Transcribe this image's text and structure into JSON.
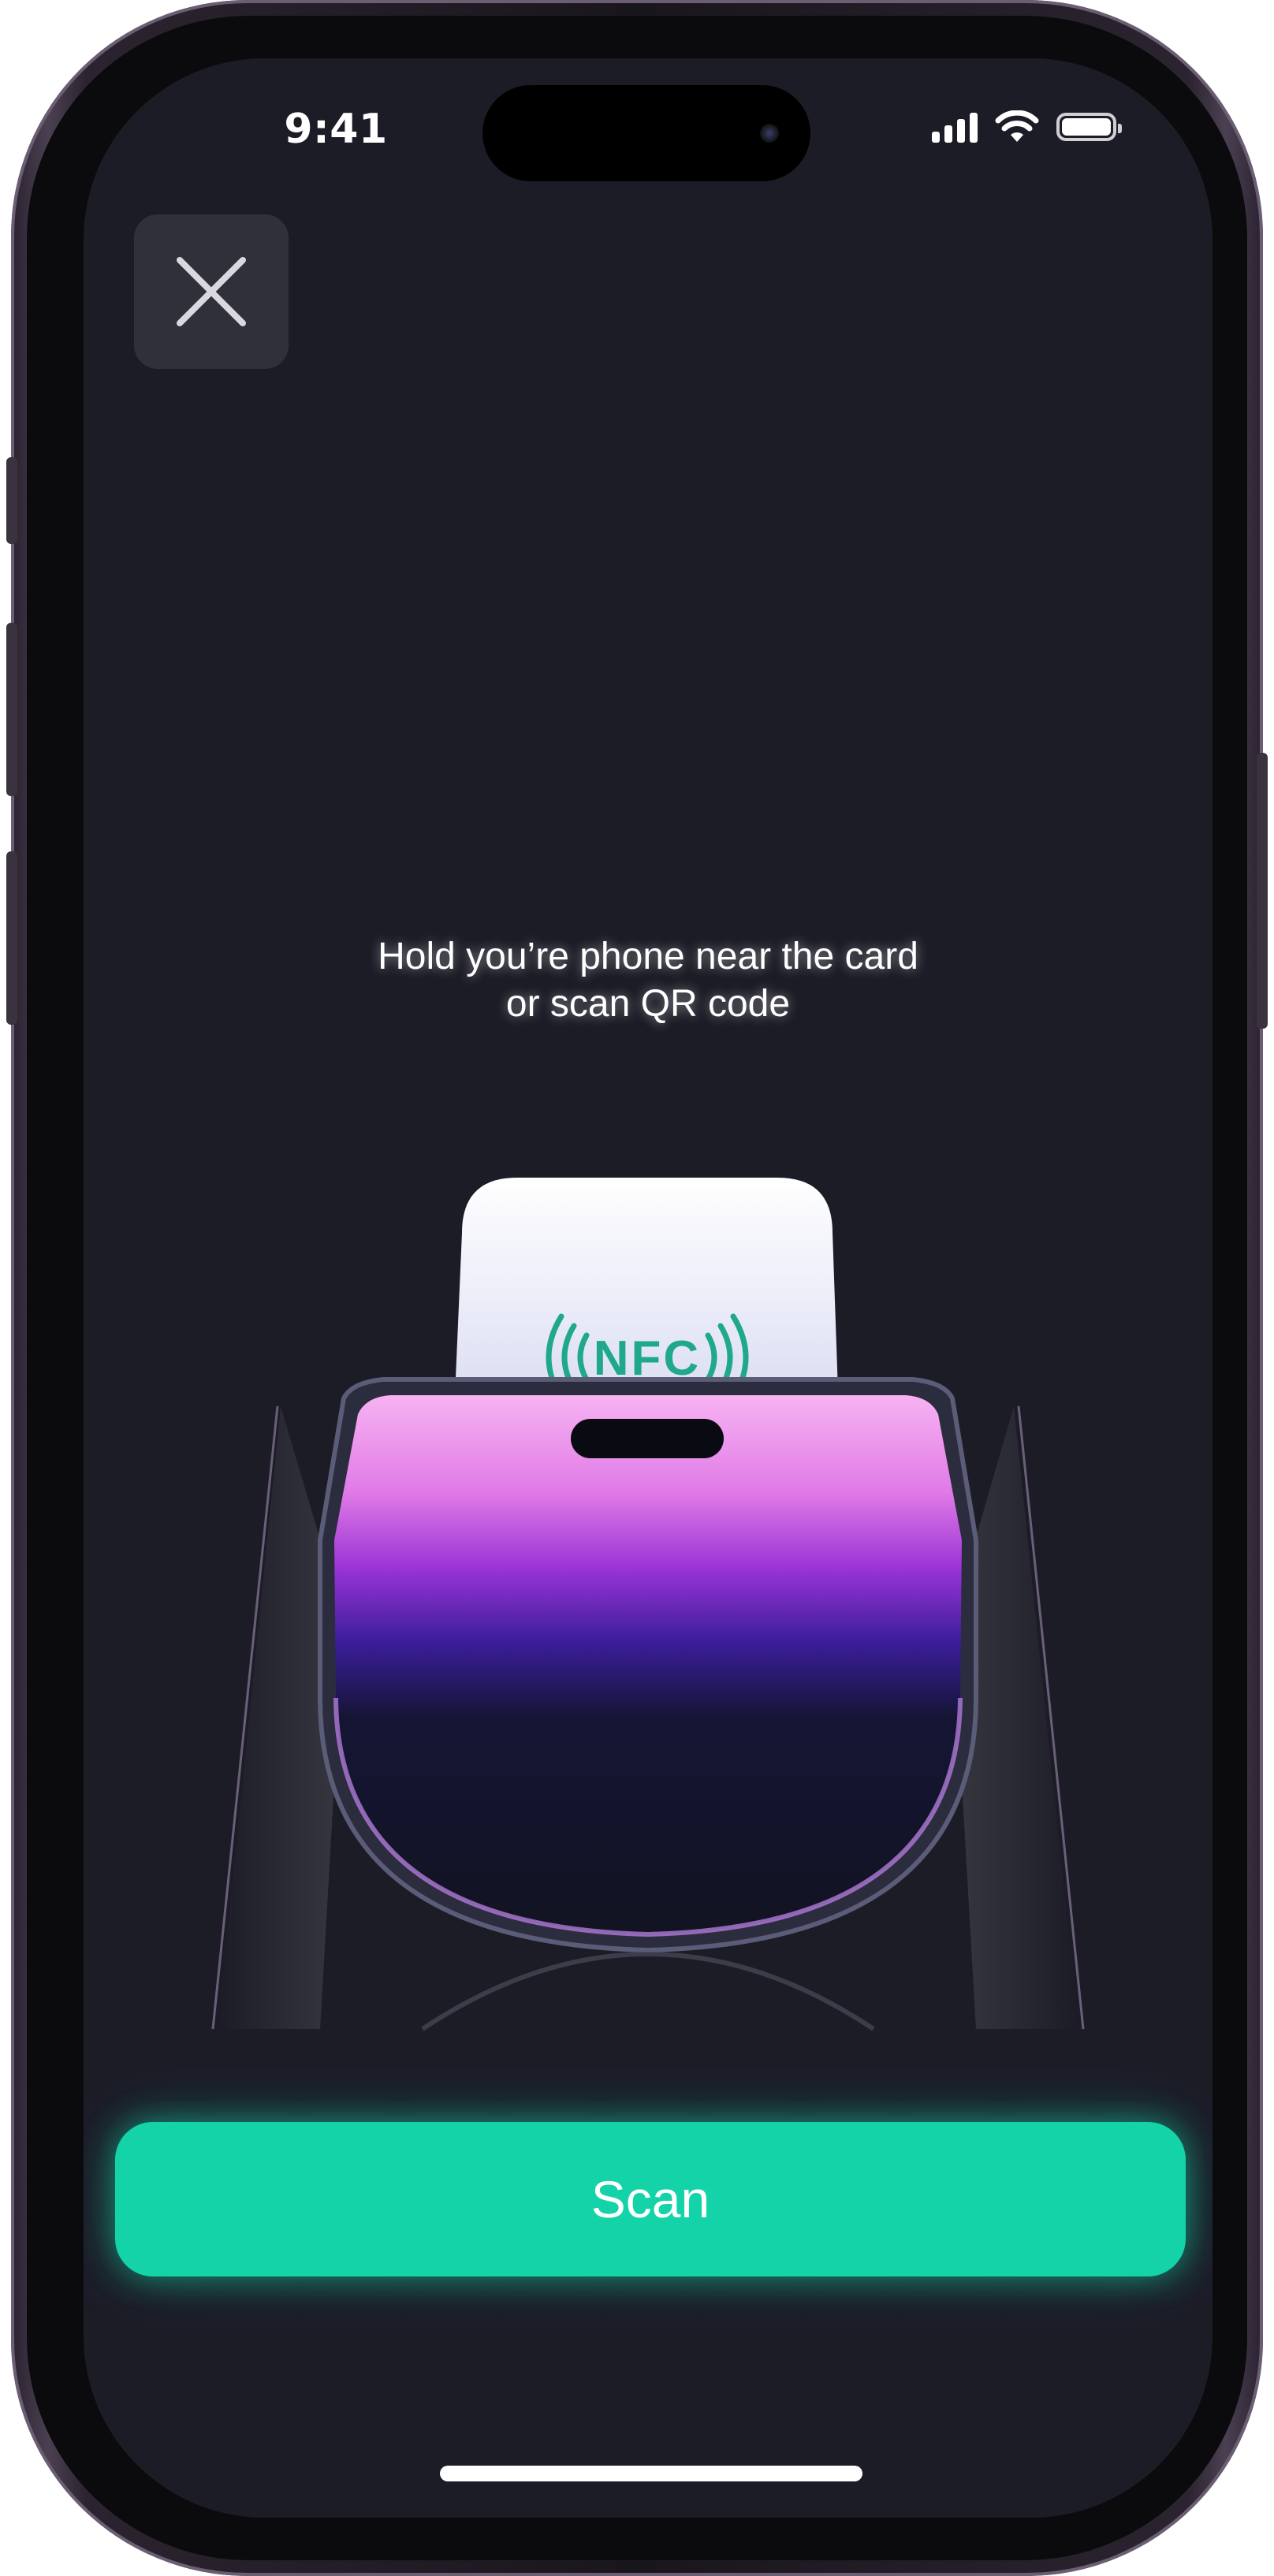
{
  "status_bar": {
    "time": "9:41",
    "icons": [
      "cellular-signal-icon",
      "wifi-icon",
      "battery-icon"
    ]
  },
  "close_button": {
    "icon": "close-icon"
  },
  "instruction": {
    "text": "Hold you’re phone near the card\nor scan QR code"
  },
  "illustration": {
    "card_label": "NFC",
    "colors": {
      "nfc_green": "#1fa98a",
      "phone_pink": "#f7a6f0",
      "phone_violet": "#7a2dd6"
    }
  },
  "scan_button": {
    "label": "Scan"
  },
  "colors": {
    "accent": "#14d3a8",
    "background": "#1c1c27",
    "close_bg": "#30303a"
  }
}
